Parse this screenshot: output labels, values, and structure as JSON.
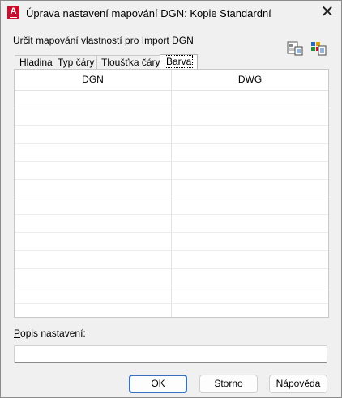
{
  "window": {
    "title": "Úprava nastavení mapování DGN: Kopie Standardní",
    "app_icon": "autocad-icon",
    "app_icon_letter": "A",
    "close_glyph": "✕"
  },
  "main": {
    "section_label": "Určit mapování vlastností pro Import DGN",
    "toolbar": [
      {
        "name": "import-mapping-icon"
      },
      {
        "name": "color-mapping-icon"
      }
    ],
    "tabs": [
      {
        "label": "Hladina",
        "active": false
      },
      {
        "label": "Typ čáry",
        "active": false
      },
      {
        "label": "Tloušťka čáry",
        "active": false
      },
      {
        "label": "Barva",
        "active": true
      }
    ],
    "table": {
      "columns": [
        "DGN",
        "DWG"
      ],
      "rows": []
    },
    "description": {
      "label_accesskey": "P",
      "label_rest": "opis nastavení:",
      "value": ""
    }
  },
  "footer": {
    "ok": "OK",
    "cancel": "Storno",
    "help": "Nápověda"
  },
  "colors": {
    "accent": "#3a6fbf",
    "app_icon": "#c8102e",
    "background": "#f0f0f0"
  }
}
